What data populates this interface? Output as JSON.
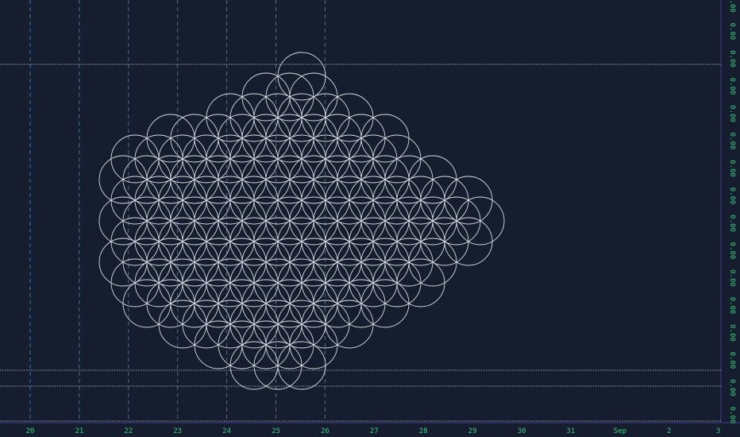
{
  "colors": {
    "background": "#161d2e",
    "grid_vertical": "#3d6fa8",
    "grid_horizontal": "#c9cfd8",
    "circle_stroke": "#d8dbe2",
    "axis_label": "#35d07f",
    "axis_line": "#3b3f8c"
  },
  "price_axis": {
    "labels": [
      "0.00",
      "0.00",
      "0.00",
      "0.00",
      "0.00",
      "0.00",
      "0.00",
      "0.00",
      "0.00",
      "0.00",
      "0.00",
      "0.00",
      "0.00",
      "0.00",
      "0.00",
      "0.00"
    ]
  },
  "time_axis": {
    "labels": [
      "20",
      "21",
      "22",
      "23",
      "24",
      "25",
      "26",
      "27",
      "28",
      "29",
      "30",
      "31",
      "Sep",
      "2",
      "3"
    ]
  },
  "drawing": {
    "shape": "flower-of-life circle grid",
    "circle_count": 140
  }
}
